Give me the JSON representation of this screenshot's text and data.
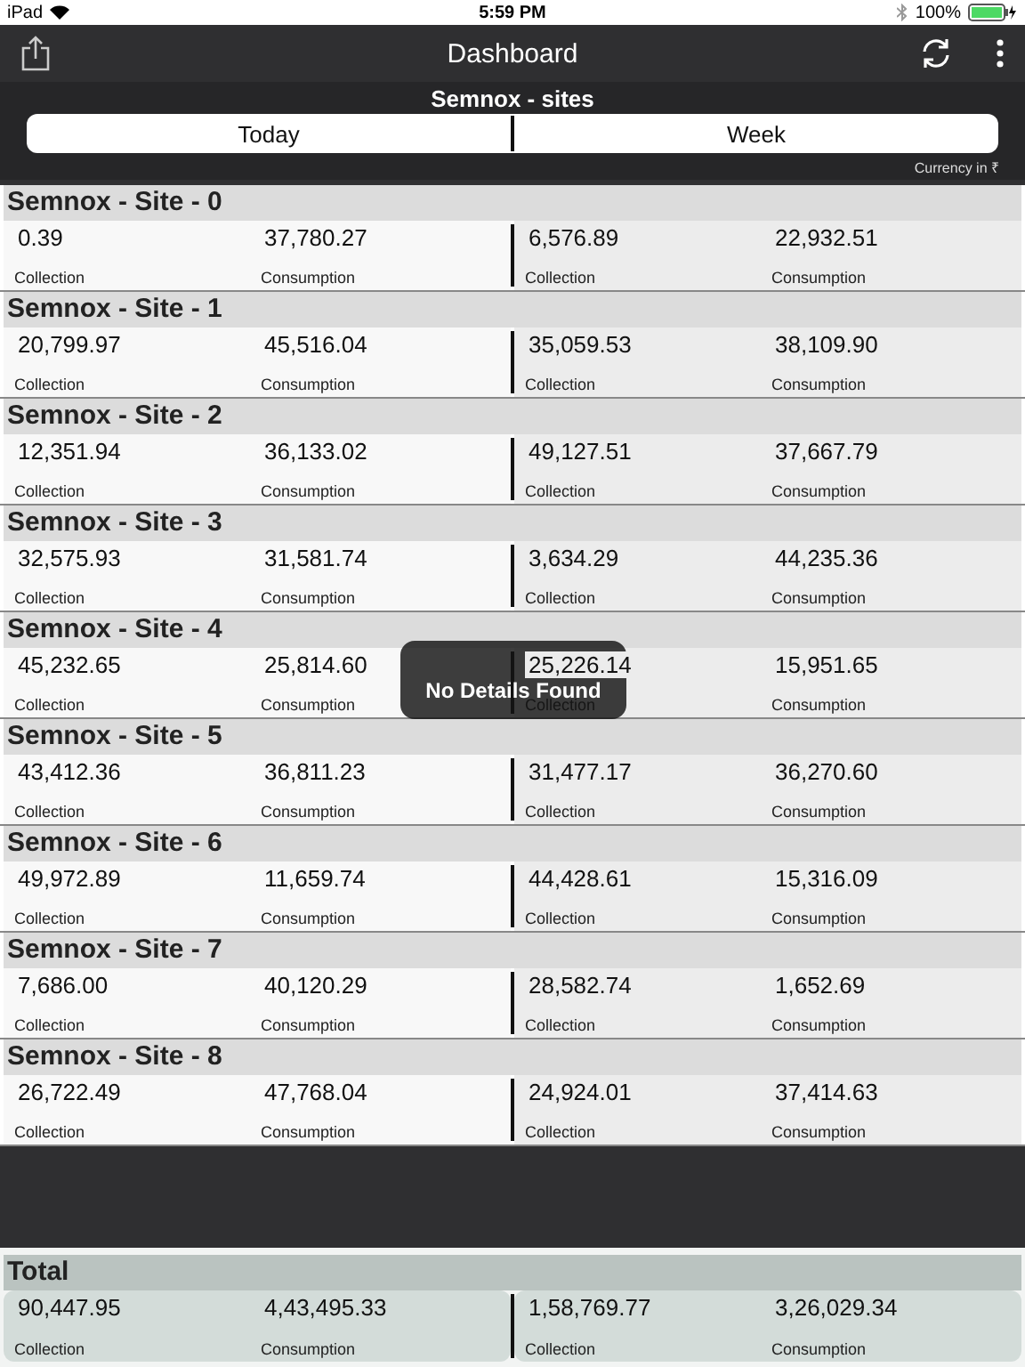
{
  "status_bar": {
    "device": "iPad",
    "time": "5:59 PM",
    "battery": "100%"
  },
  "header": {
    "title": "Dashboard"
  },
  "subtitle": "Semnox - sites",
  "segments": [
    {
      "label": "Today"
    },
    {
      "label": "Week"
    }
  ],
  "currency_note": "Currency in ₹",
  "sites": [
    {
      "name": "Semnox - Site - 0",
      "today": [
        {
          "value": "0.39",
          "label": "Collection"
        },
        {
          "value": "37,780.27",
          "label": "Consumption"
        }
      ],
      "week": [
        {
          "value": "6,576.89",
          "label": "Collection"
        },
        {
          "value": "22,932.51",
          "label": "Consumption"
        }
      ]
    },
    {
      "name": "Semnox - Site - 1",
      "today": [
        {
          "value": "20,799.97",
          "label": "Collection"
        },
        {
          "value": "45,516.04",
          "label": "Consumption"
        }
      ],
      "week": [
        {
          "value": "35,059.53",
          "label": "Collection"
        },
        {
          "value": "38,109.90",
          "label": "Consumption"
        }
      ]
    },
    {
      "name": "Semnox - Site - 2",
      "today": [
        {
          "value": "12,351.94",
          "label": "Collection"
        },
        {
          "value": "36,133.02",
          "label": "Consumption"
        }
      ],
      "week": [
        {
          "value": "49,127.51",
          "label": "Collection"
        },
        {
          "value": "37,667.79",
          "label": "Consumption"
        }
      ]
    },
    {
      "name": "Semnox - Site - 3",
      "today": [
        {
          "value": "32,575.93",
          "label": "Collection"
        },
        {
          "value": "31,581.74",
          "label": "Consumption"
        }
      ],
      "week": [
        {
          "value": "3,634.29",
          "label": "Collection"
        },
        {
          "value": "44,235.36",
          "label": "Consumption"
        }
      ]
    },
    {
      "name": "Semnox - Site - 4",
      "today": [
        {
          "value": "45,232.65",
          "label": "Collection"
        },
        {
          "value": "25,814.60",
          "label": "Consumption"
        }
      ],
      "week": [
        {
          "value": "25,226.14",
          "label": "Collection"
        },
        {
          "value": "15,951.65",
          "label": "Consumption"
        }
      ]
    },
    {
      "name": "Semnox - Site - 5",
      "today": [
        {
          "value": "43,412.36",
          "label": "Collection"
        },
        {
          "value": "36,811.23",
          "label": "Consumption"
        }
      ],
      "week": [
        {
          "value": "31,477.17",
          "label": "Collection"
        },
        {
          "value": "36,270.60",
          "label": "Consumption"
        }
      ]
    },
    {
      "name": "Semnox - Site - 6",
      "today": [
        {
          "value": "49,972.89",
          "label": "Collection"
        },
        {
          "value": "11,659.74",
          "label": "Consumption"
        }
      ],
      "week": [
        {
          "value": "44,428.61",
          "label": "Collection"
        },
        {
          "value": "15,316.09",
          "label": "Consumption"
        }
      ]
    },
    {
      "name": "Semnox - Site - 7",
      "today": [
        {
          "value": "7,686.00",
          "label": "Collection"
        },
        {
          "value": "40,120.29",
          "label": "Consumption"
        }
      ],
      "week": [
        {
          "value": "28,582.74",
          "label": "Collection"
        },
        {
          "value": "1,652.69",
          "label": "Consumption"
        }
      ]
    },
    {
      "name": "Semnox - Site - 8",
      "today": [
        {
          "value": "26,722.49",
          "label": "Collection"
        },
        {
          "value": "47,768.04",
          "label": "Consumption"
        }
      ],
      "week": [
        {
          "value": "24,924.01",
          "label": "Collection"
        },
        {
          "value": "37,414.63",
          "label": "Consumption"
        }
      ]
    }
  ],
  "total": {
    "name": "Total",
    "today": [
      {
        "value": "90,447.95",
        "label": "Collection"
      },
      {
        "value": "4,43,495.33",
        "label": "Consumption"
      }
    ],
    "week": [
      {
        "value": "1,58,769.77",
        "label": "Collection"
      },
      {
        "value": "3,26,029.34",
        "label": "Consumption"
      }
    ]
  },
  "toast": "No Details Found"
}
